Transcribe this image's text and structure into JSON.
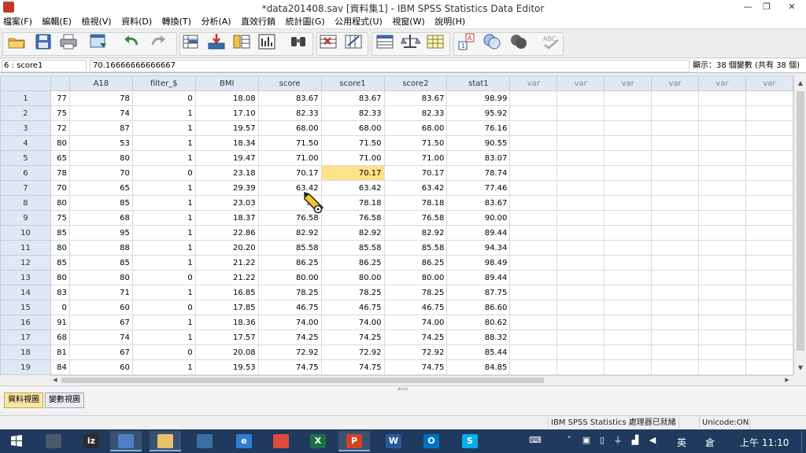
{
  "window": {
    "title": "*data201408.sav [資料集1] - IBM SPSS Statistics Data Editor",
    "minimize": "—",
    "restore": "❐",
    "close": "✕"
  },
  "menu": [
    "檔案(F)",
    "編輯(E)",
    "檢視(V)",
    "資料(D)",
    "轉換(T)",
    "分析(A)",
    "直效行銷",
    "統計圖(G)",
    "公用程式(U)",
    "視窗(W)",
    "說明(H)"
  ],
  "toolbar": {
    "icons": [
      "open-folder-icon",
      "save-icon",
      "print-icon",
      "dialog-recall-icon",
      "undo-icon",
      "redo-icon",
      "goto-case-icon",
      "goto-variable-icon",
      "variables-icon",
      "run-descriptives-icon",
      "find-icon",
      "insert-cases-icon",
      "insert-variable-icon",
      "split-file-icon",
      "weight-cases-icon",
      "select-cases-icon",
      "value-labels-icon",
      "use-sets-icon",
      "show-all-variables-icon",
      "spell-check-icon"
    ]
  },
  "infobar": {
    "cell_reference": "6 : score1",
    "cell_value": "70.16666666666667",
    "visible_label": "顯示：38 個變數 (共有 38 個)"
  },
  "grid": {
    "columns": [
      "",
      "A18",
      "filter_$",
      "BMI",
      "score",
      "score1",
      "score2",
      "stat1",
      "var",
      "var",
      "var",
      "var",
      "var",
      "var"
    ],
    "rows": [
      {
        "num": "1",
        "cells": [
          "77",
          "78",
          "0",
          "18.08",
          "83.67",
          "83.67",
          "83.67",
          "98.99"
        ]
      },
      {
        "num": "2",
        "cells": [
          "75",
          "74",
          "1",
          "17.10",
          "82.33",
          "82.33",
          "82.33",
          "95.92"
        ]
      },
      {
        "num": "3",
        "cells": [
          "72",
          "87",
          "1",
          "19.57",
          "68.00",
          "68.00",
          "68.00",
          "76.16"
        ]
      },
      {
        "num": "4",
        "cells": [
          "80",
          "53",
          "1",
          "18.34",
          "71.50",
          "71.50",
          "71.50",
          "90.55"
        ]
      },
      {
        "num": "5",
        "cells": [
          "65",
          "80",
          "1",
          "19.47",
          "71.00",
          "71.00",
          "71.00",
          "83.07"
        ]
      },
      {
        "num": "6",
        "cells": [
          "78",
          "70",
          "0",
          "23.18",
          "70.17",
          "70.17",
          "70.17",
          "78.74"
        ]
      },
      {
        "num": "7",
        "cells": [
          "70",
          "65",
          "1",
          "29.39",
          "63.42",
          "63.42",
          "63.42",
          "77.46"
        ]
      },
      {
        "num": "8",
        "cells": [
          "80",
          "85",
          "1",
          "23.03",
          "78.",
          "78.18",
          "78.18",
          "83.67"
        ]
      },
      {
        "num": "9",
        "cells": [
          "75",
          "68",
          "1",
          "18.37",
          "76.58",
          "76.58",
          "76.58",
          "90.00"
        ]
      },
      {
        "num": "10",
        "cells": [
          "85",
          "95",
          "1",
          "22.86",
          "82.92",
          "82.92",
          "82.92",
          "89.44"
        ]
      },
      {
        "num": "11",
        "cells": [
          "80",
          "88",
          "1",
          "20.20",
          "85.58",
          "85.58",
          "85.58",
          "94.34"
        ]
      },
      {
        "num": "12",
        "cells": [
          "85",
          "85",
          "1",
          "21.22",
          "86.25",
          "86.25",
          "86.25",
          "98.49"
        ]
      },
      {
        "num": "13",
        "cells": [
          "80",
          "80",
          "0",
          "21.22",
          "80.00",
          "80.00",
          "80.00",
          "89.44"
        ]
      },
      {
        "num": "14",
        "cells": [
          "83",
          "71",
          "1",
          "16.85",
          "78.25",
          "78.25",
          "78.25",
          "87.75"
        ]
      },
      {
        "num": "15",
        "cells": [
          "0",
          "60",
          "0",
          "17.85",
          "46.75",
          "46.75",
          "46.75",
          "86.60"
        ]
      },
      {
        "num": "16",
        "cells": [
          "91",
          "67",
          "1",
          "18.36",
          "74.00",
          "74.00",
          "74.00",
          "80.62"
        ]
      },
      {
        "num": "17",
        "cells": [
          "68",
          "74",
          "1",
          "17.57",
          "74.25",
          "74.25",
          "74.25",
          "88.32"
        ]
      },
      {
        "num": "18",
        "cells": [
          "81",
          "67",
          "0",
          "20.08",
          "72.92",
          "72.92",
          "72.92",
          "85.44"
        ]
      },
      {
        "num": "19",
        "cells": [
          "84",
          "60",
          "1",
          "19.53",
          "74.75",
          "74.75",
          "74.75",
          "84.85"
        ]
      }
    ]
  },
  "view_tabs": {
    "data_view": "資料視圖",
    "variable_view": "變數視圖"
  },
  "status": {
    "processor": "IBM SPSS Statistics 處理器已就緒",
    "unicode": "Unicode:ON"
  },
  "taskbar": {
    "apps": [
      {
        "name": "start-button",
        "label": "",
        "color": "#1f3a5e"
      },
      {
        "name": "taskbar-printer-app",
        "label": "",
        "color": "#4a5a6a"
      },
      {
        "name": "taskbar-tablet-app",
        "label": "iz",
        "color": "#2b2b2b"
      },
      {
        "name": "taskbar-spss-app",
        "label": "",
        "color": "#4d80c4"
      },
      {
        "name": "taskbar-explorer-app",
        "label": "",
        "color": "#e7c167"
      },
      {
        "name": "taskbar-app-5",
        "label": "",
        "color": "#3b6ea5"
      },
      {
        "name": "taskbar-ie-app",
        "label": "e",
        "color": "#2f7fd4"
      },
      {
        "name": "taskbar-chrome-app",
        "label": "",
        "color": "#dd4b39"
      },
      {
        "name": "taskbar-excel-app",
        "label": "X",
        "color": "#1d6f42"
      },
      {
        "name": "taskbar-powerpoint-app",
        "label": "P",
        "color": "#d04423"
      },
      {
        "name": "taskbar-word-app",
        "label": "W",
        "color": "#2b579a"
      },
      {
        "name": "taskbar-outlook-app",
        "label": "O",
        "color": "#0072c6"
      },
      {
        "name": "taskbar-skype-app",
        "label": "S",
        "color": "#00aff0"
      }
    ],
    "ime_lang": "英",
    "ime_mode": "倉",
    "clock": "上午 11:10"
  }
}
